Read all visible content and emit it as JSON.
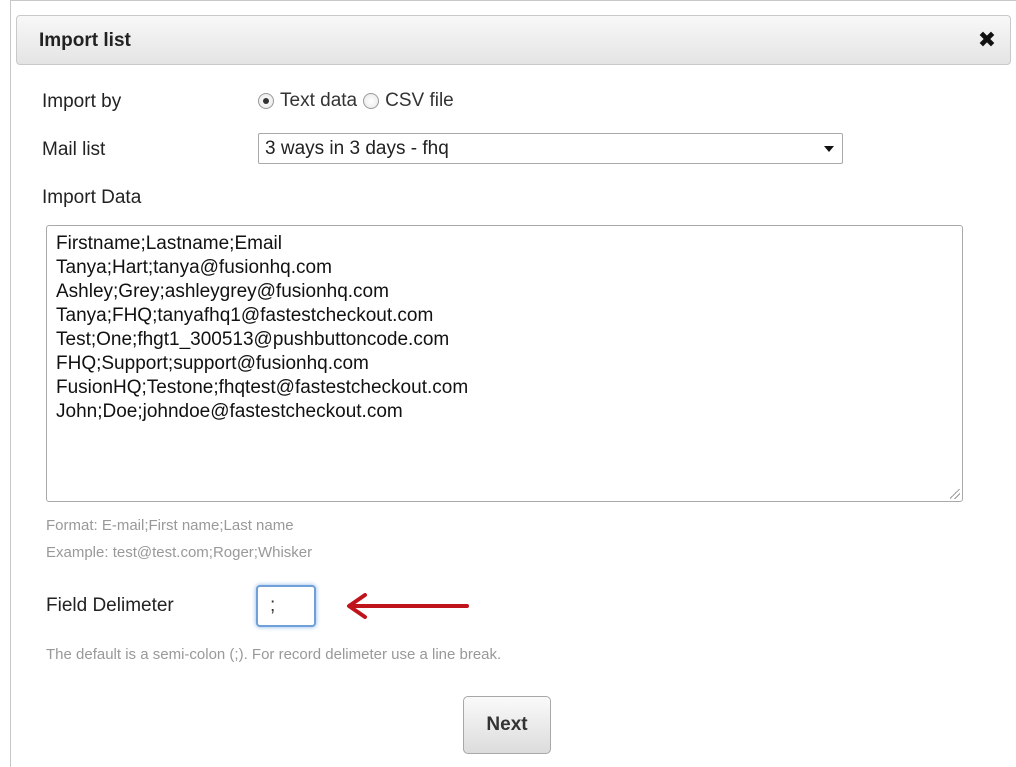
{
  "dialog": {
    "title": "Import list",
    "close_glyph": "✖"
  },
  "import_by": {
    "label": "Import by",
    "options": [
      {
        "label": "Text data",
        "selected": true
      },
      {
        "label": "CSV file",
        "selected": false
      }
    ]
  },
  "mail_list": {
    "label": "Mail list",
    "selected": "3 ways in 3 days - fhq"
  },
  "import_data": {
    "label": "Import Data",
    "lines": [
      "Firstname;Lastname;Email",
      "Tanya;Hart;tanya@fusionhq.com",
      "Ashley;Grey;ashleygrey@fusionhq.com",
      "Tanya;FHQ;tanyafhq1@fastestcheckout.com",
      "Test;One;fhgt1_300513@pushbuttoncode.com",
      "FHQ;Support;support@fusionhq.com",
      "FusionHQ;Testone;fhqtest@fastestcheckout.com",
      "John;Doe;johndoe@fastestcheckout.com"
    ],
    "format_hint": "Format: E-mail;First name;Last name",
    "example_hint": "Example: test@test.com;Roger;Whisker"
  },
  "field_delimiter": {
    "label": "Field Delimeter",
    "value": ";",
    "hint": "The default is a semi-colon (;). For record delimeter use a line break."
  },
  "annotation": {
    "arrow_color": "#c0141c"
  },
  "actions": {
    "next_label": "Next"
  }
}
